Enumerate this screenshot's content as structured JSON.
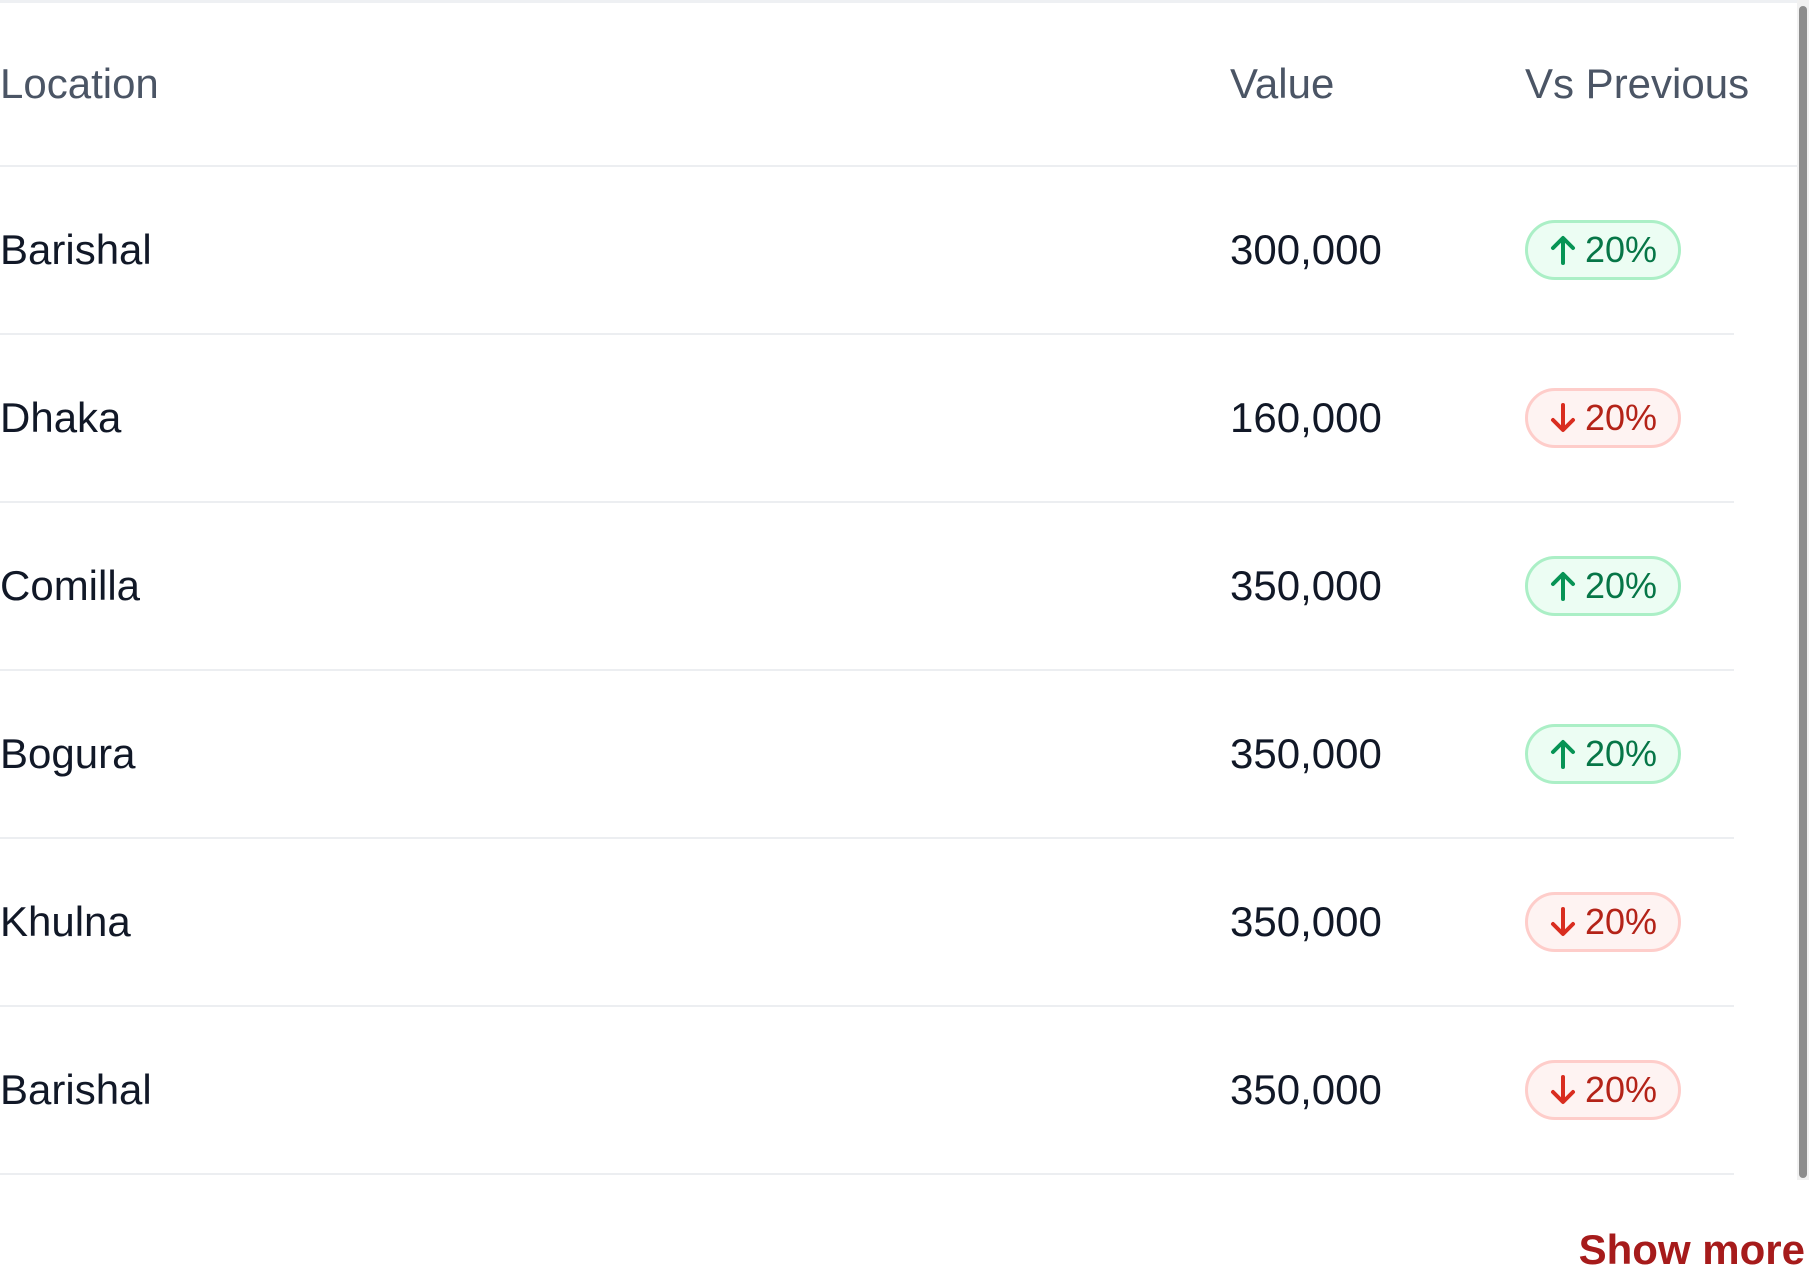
{
  "table": {
    "headers": {
      "location": "Location",
      "value": "Value",
      "vs_previous": "Vs Previous"
    },
    "rows": [
      {
        "location": "Barishal",
        "value": "300,000",
        "change": "20%",
        "direction": "up"
      },
      {
        "location": "Dhaka",
        "value": "160,000",
        "change": "20%",
        "direction": "down"
      },
      {
        "location": "Comilla",
        "value": "350,000",
        "change": "20%",
        "direction": "up"
      },
      {
        "location": "Bogura",
        "value": "350,000",
        "change": "20%",
        "direction": "up"
      },
      {
        "location": "Khulna",
        "value": "350,000",
        "change": "20%",
        "direction": "down"
      },
      {
        "location": "Barishal",
        "value": "350,000",
        "change": "20%",
        "direction": "down"
      }
    ]
  },
  "footer": {
    "show_more_label": "Show more"
  },
  "colors": {
    "up_text": "#067647",
    "up_background": "#ecfdf3",
    "down_text": "#b42318",
    "down_background": "#fef3f2",
    "link": "#a61b1b"
  },
  "icons": {
    "up": "arrow-up-icon",
    "down": "arrow-down-icon"
  }
}
